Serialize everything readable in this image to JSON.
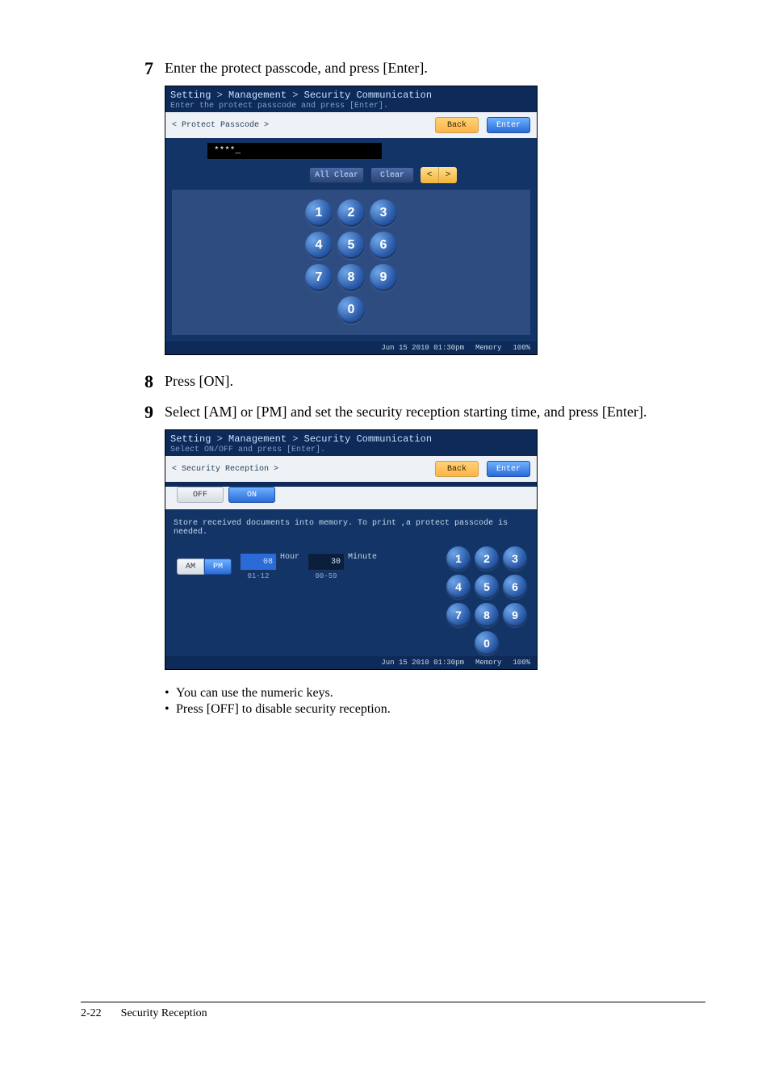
{
  "steps": {
    "s7": {
      "num": "7",
      "text": "Enter the protect passcode, and press [Enter]."
    },
    "s8": {
      "num": "8",
      "text": "Press [ON]."
    },
    "s9": {
      "num": "9",
      "text": "Select [AM] or [PM] and set the security reception starting time, and press [Enter]."
    }
  },
  "screen1": {
    "breadcrumb": {
      "a": "Setting",
      "b": "Management",
      "c": "Security Communication",
      "sep": ">"
    },
    "subtext": "Enter the protect passcode and press [Enter].",
    "panel_label": "< Protect Passcode >",
    "back": "Back",
    "enter": "Enter",
    "input_value": "****_",
    "all_clear": "All Clear",
    "clear": "Clear",
    "arrow_left": "<",
    "arrow_right": ">",
    "footer": {
      "datetime": "Jun 15 2010 01:30pm",
      "memory_label": "Memory",
      "memory_value": "100%"
    }
  },
  "keypad": {
    "k1": "1",
    "k2": "2",
    "k3": "3",
    "k4": "4",
    "k5": "5",
    "k6": "6",
    "k7": "7",
    "k8": "8",
    "k9": "9",
    "k0": "0"
  },
  "screen2": {
    "breadcrumb": {
      "a": "Setting",
      "b": "Management",
      "c": "Security Communication",
      "sep": ">"
    },
    "subtext": "Select ON/OFF and press [Enter].",
    "panel_label": "< Security Reception >",
    "back": "Back",
    "enter": "Enter",
    "off": "OFF",
    "on": "ON",
    "info": "Store received documents into memory. To print ,a protect passcode is needed.",
    "am": "AM",
    "pm": "PM",
    "hour_value": "08",
    "hour_label": "Hour",
    "hour_range": "01-12",
    "minute_value": "30",
    "minute_label": "Minute",
    "minute_range": "00-59",
    "footer": {
      "datetime": "Jun 15 2010 01:30pm",
      "memory_label": "Memory",
      "memory_value": "100%"
    }
  },
  "notes": {
    "n1": "You can use the numeric keys.",
    "n2": "Press [OFF] to disable security reception.",
    "bullet": "•"
  },
  "footer": {
    "page": "2-22",
    "title": "Security Reception"
  }
}
